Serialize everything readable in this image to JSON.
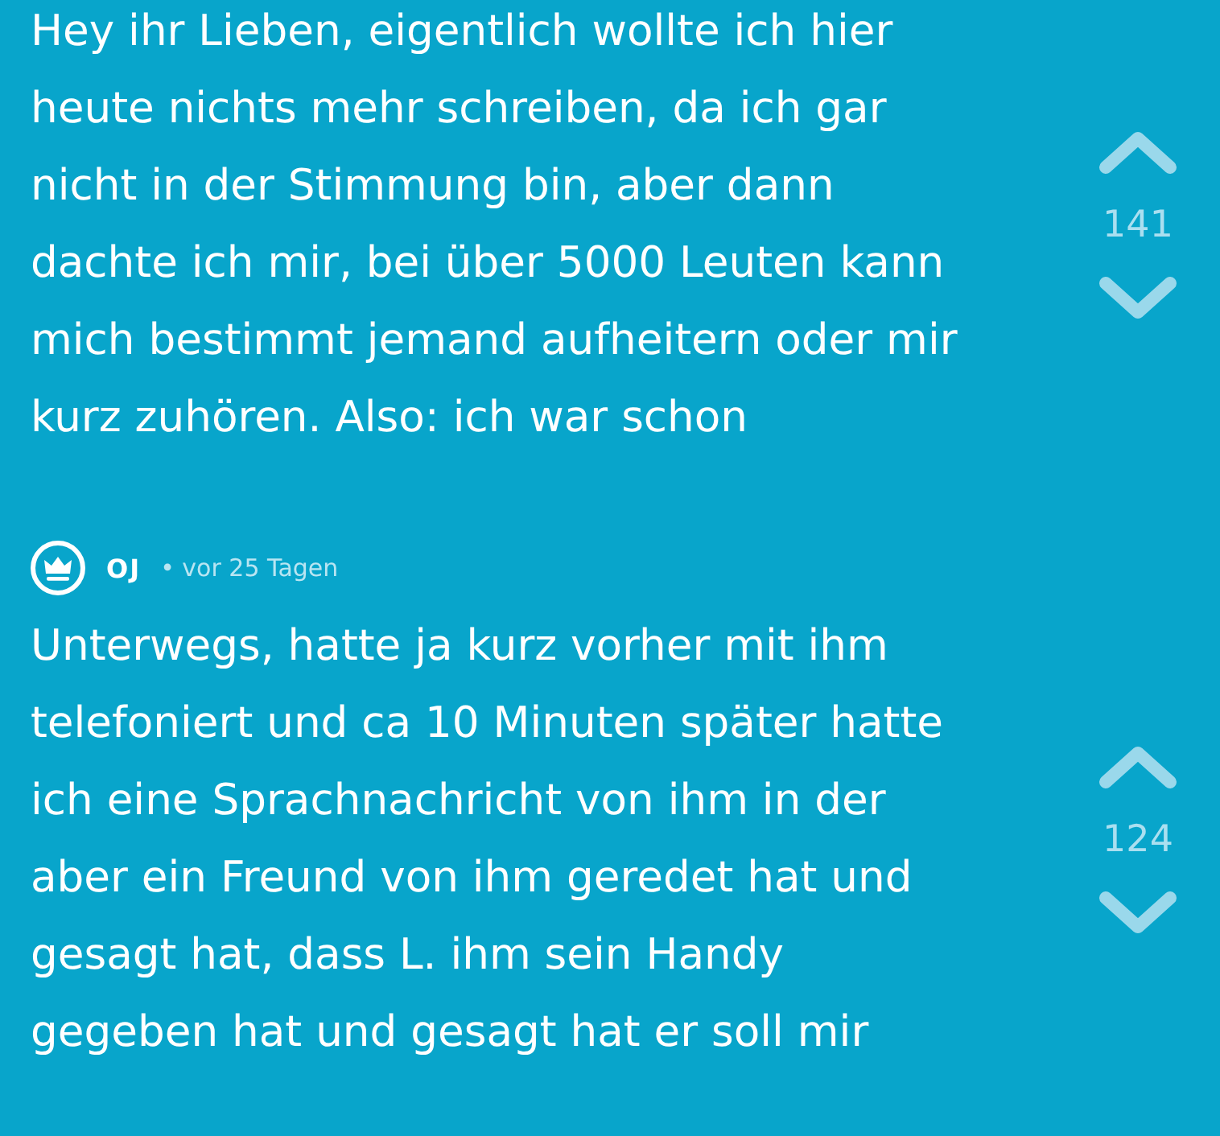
{
  "posts": [
    {
      "text": "Hey ihr Lieben, eigentlich wollte ich hier\nheute nichts mehr schreiben, da ich gar\nnicht in der Stimmung bin, aber dann\ndachte ich mir, bei über 5000 Leuten kann\nmich bestimmt jemand aufheitern oder mir\nkurz zuhören. Also: ich war schon",
      "votes": "141"
    },
    {
      "author": "OJ",
      "time": "• vor 25 Tagen",
      "text": "Unterwegs, hatte ja kurz vorher mit ihm\ntelefoniert und ca 10 Minuten später hatte\nich eine Sprachnachricht von ihm in der\naber ein Freund von ihm geredet hat und\ngesagt hat, dass L. ihm sein Handy\ngegeben hat und gesagt hat er soll mir",
      "votes": "124"
    }
  ]
}
